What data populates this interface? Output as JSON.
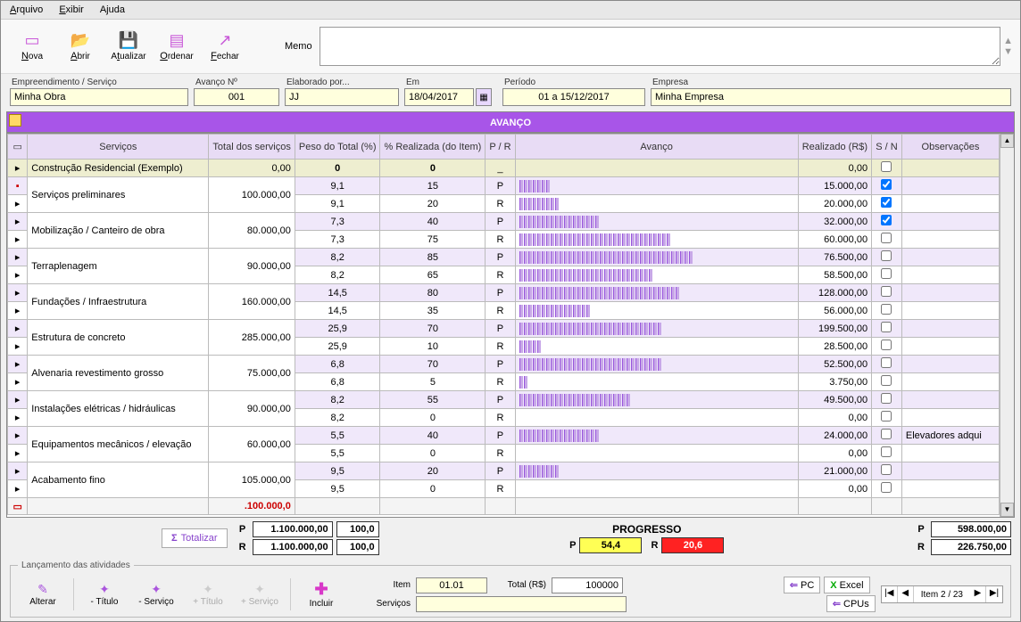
{
  "menu": {
    "arquivo": "Arquivo",
    "exibir": "Exibir",
    "ajuda": "Ajuda"
  },
  "toolbar": {
    "nova": "Nova",
    "abrir": "Abrir",
    "atualizar": "Atualizar",
    "ordenar": "Ordenar",
    "fechar": "Fechar",
    "memo_lbl": "Memo"
  },
  "hdr": {
    "emp_lbl": "Empreendimento / Serviço",
    "emp_val": "Minha Obra",
    "av_lbl": "Avanço Nº",
    "av_val": "001",
    "elab_lbl": "Elaborado por...",
    "elab_val": "JJ",
    "em_lbl": "Em",
    "em_val": "18/04/2017",
    "per_lbl": "Período",
    "per_val": "01 a 15/12/2017",
    "empresa_lbl": "Empresa",
    "empresa_val": "Minha Empresa"
  },
  "band": "AVANÇO",
  "cols": {
    "servicos": "Serviços",
    "total": "Total dos serviços",
    "peso": "Peso do Total (%)",
    "realiz": "% Realizada (do Item)",
    "pr": "P / R",
    "avanco": "Avanço",
    "valor": "Realizado (R$)",
    "sn": "S / N",
    "obs": "Observações"
  },
  "rows": [
    {
      "serv": "Construção Residencial (Exemplo)",
      "tot": "0,00",
      "pP": "0",
      "rP": "",
      "pR": "0",
      "rR": "",
      "pr": "_",
      "barP": 0,
      "valP": "0,00",
      "snP": false,
      "single": true,
      "first": true
    },
    {
      "serv": "Serviços preliminares",
      "tot": "100.000,00",
      "pP": "9,1",
      "rP": "15",
      "pR": "9,1",
      "rR": "20",
      "barP": 15,
      "barR": 20,
      "valP": "15.000,00",
      "valR": "20.000,00",
      "snP": true,
      "snR": true
    },
    {
      "serv": "Mobilização / Canteiro de obra",
      "tot": "80.000,00",
      "pP": "7,3",
      "rP": "40",
      "pR": "7,3",
      "rR": "75",
      "barP": 40,
      "barR": 75,
      "valP": "32.000,00",
      "valR": "60.000,00",
      "snP": true,
      "snR": false
    },
    {
      "serv": "Terraplenagem",
      "tot": "90.000,00",
      "pP": "8,2",
      "rP": "85",
      "pR": "8,2",
      "rR": "65",
      "barP": 85,
      "barR": 65,
      "valP": "76.500,00",
      "valR": "58.500,00",
      "snP": false,
      "snR": false
    },
    {
      "serv": "Fundações / Infraestrutura",
      "tot": "160.000,00",
      "pP": "14,5",
      "rP": "80",
      "pR": "14,5",
      "rR": "35",
      "barP": 80,
      "barR": 35,
      "valP": "128.000,00",
      "valR": "56.000,00",
      "snP": false,
      "snR": false
    },
    {
      "serv": "Estrutura de concreto",
      "tot": "285.000,00",
      "pP": "25,9",
      "rP": "70",
      "pR": "25,9",
      "rR": "10",
      "barP": 70,
      "barR": 10,
      "valP": "199.500,00",
      "valR": "28.500,00",
      "snP": false,
      "snR": false
    },
    {
      "serv": "Alvenaria revestimento grosso",
      "tot": "75.000,00",
      "pP": "6,8",
      "rP": "70",
      "pR": "6,8",
      "rR": "5",
      "barP": 70,
      "barR": 5,
      "valP": "52.500,00",
      "valR": "3.750,00",
      "snP": false,
      "snR": false
    },
    {
      "serv": "Instalações elétricas / hidráulicas",
      "tot": "90.000,00",
      "pP": "8,2",
      "rP": "55",
      "pR": "8,2",
      "rR": "0",
      "barP": 55,
      "barR": 0,
      "valP": "49.500,00",
      "valR": "0,00",
      "snP": false,
      "snR": false
    },
    {
      "serv": "Equipamentos mecânicos / elevação",
      "tot": "60.000,00",
      "pP": "5,5",
      "rP": "40",
      "pR": "5,5",
      "rR": "0",
      "barP": 40,
      "barR": 0,
      "valP": "24.000,00",
      "valR": "0,00",
      "snP": false,
      "snR": false,
      "obsP": "Elevadores adqui"
    },
    {
      "serv": "Acabamento fino",
      "tot": "105.000,00",
      "pP": "9,5",
      "rP": "20",
      "pR": "9,5",
      "rR": "0",
      "barP": 20,
      "barR": 0,
      "valP": "21.000,00",
      "valR": "0,00",
      "snP": false,
      "snR": false
    }
  ],
  "sum": {
    "tot": ".100.000,0"
  },
  "totals": {
    "btn": "Totalizar",
    "p_val": "1.100.000,00",
    "p_pct": "100,0",
    "r_val": "1.100.000,00",
    "r_pct": "100,0",
    "prog_title": "PROGRESSO",
    "prog_p": "54,4",
    "prog_r": "20,6",
    "right_p": "598.000,00",
    "right_r": "226.750,00"
  },
  "lanc": {
    "legend": "Lançamento das atividades",
    "alterar": "Alterar",
    "mtitulo": "- Título",
    "mserv": "- Serviço",
    "ptitulo": "+ Título",
    "pserv": "+ Serviço",
    "incluir": "Incluir",
    "item_lbl": "Item",
    "item_val": "01.01",
    "total_lbl": "Total (R$)",
    "total_val": "100000",
    "serv_lbl": "Serviços",
    "serv_val": "",
    "pc": "PC",
    "excel": "Excel",
    "cpus": "CPUs",
    "nav": "Item 2 / 23"
  }
}
